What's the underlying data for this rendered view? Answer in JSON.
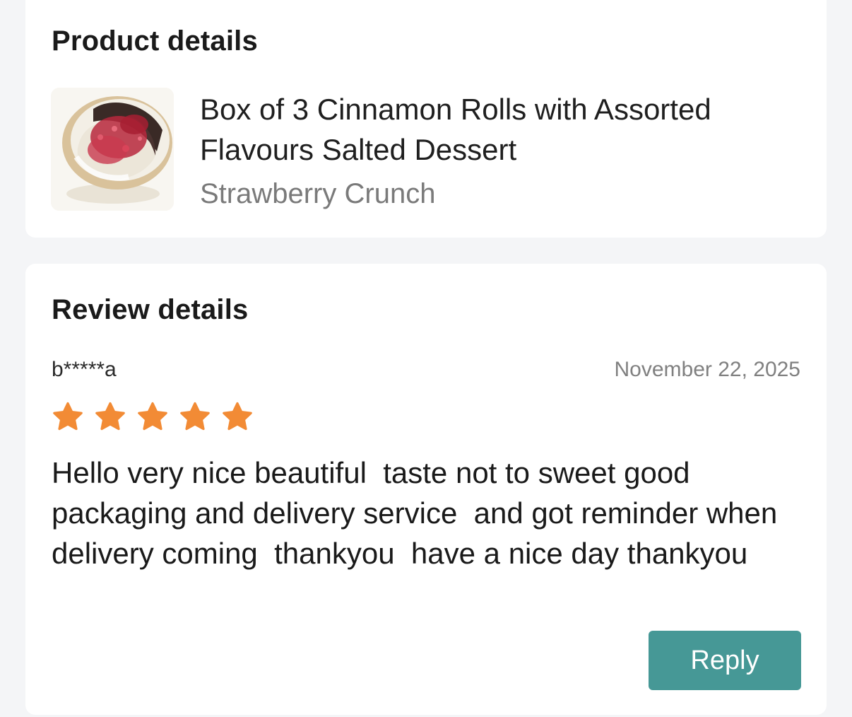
{
  "product_section": {
    "title": "Product details",
    "product_name": "Box of 3 Cinnamon Rolls with Assorted Flavours Salted Dessert",
    "variant": "Strawberry Crunch",
    "thumbnail_icon": "cinnamon-roll-image"
  },
  "review_section": {
    "title": "Review details",
    "reviewer": "b*****a",
    "date": "November 22, 2025",
    "rating": 5,
    "rating_max": 5,
    "star_color": "#f28b35",
    "text": "Hello very nice beautiful  taste not to sweet good packaging and delivery service  and got reminder when delivery coming  thankyou  have a nice day thankyou",
    "reply_label": "Reply",
    "reply_color": "#469896"
  }
}
